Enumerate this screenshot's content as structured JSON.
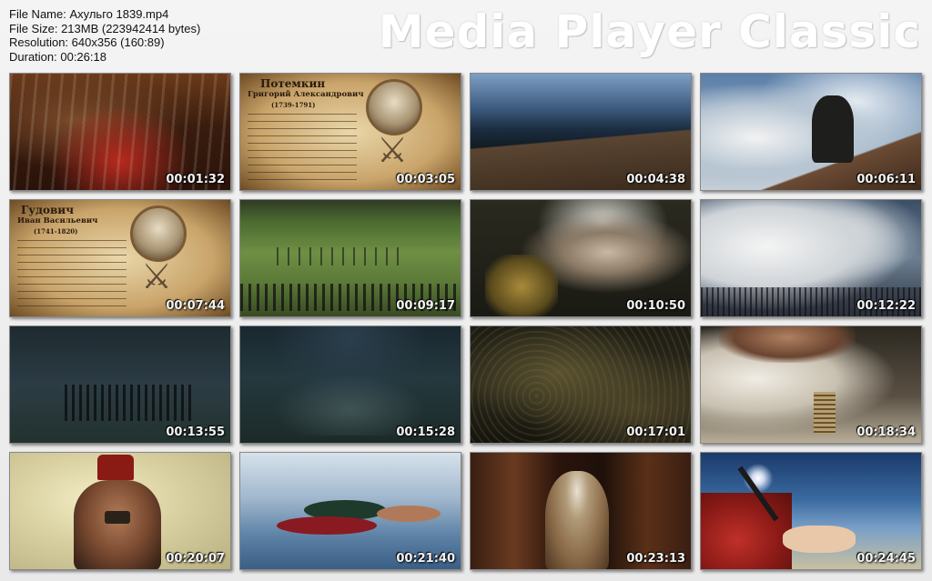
{
  "info": {
    "file_name": "File Name: Ахульго 1839.mp4",
    "file_size": "File Size: 213MB (223942414 bytes)",
    "resolution": "Resolution: 640x356 (160:89)",
    "duration": "Duration: 00:26:18"
  },
  "brand": "Media Player Classic",
  "cards": {
    "potemkin": {
      "title": "Потемкин",
      "name": "Григорий Александрович",
      "years": "(1739-1791)"
    },
    "gudovich": {
      "title": "Гудович",
      "name": "Иван Васильевич",
      "years": "(1741-1820)"
    }
  },
  "thumbnails": [
    {
      "time": "00:01:32"
    },
    {
      "time": "00:03:05"
    },
    {
      "time": "00:04:38"
    },
    {
      "time": "00:06:11"
    },
    {
      "time": "00:07:44"
    },
    {
      "time": "00:09:17"
    },
    {
      "time": "00:10:50"
    },
    {
      "time": "00:12:22"
    },
    {
      "time": "00:13:55"
    },
    {
      "time": "00:15:28"
    },
    {
      "time": "00:17:01"
    },
    {
      "time": "00:18:34"
    },
    {
      "time": "00:20:07"
    },
    {
      "time": "00:21:40"
    },
    {
      "time": "00:23:13"
    },
    {
      "time": "00:24:45"
    }
  ]
}
